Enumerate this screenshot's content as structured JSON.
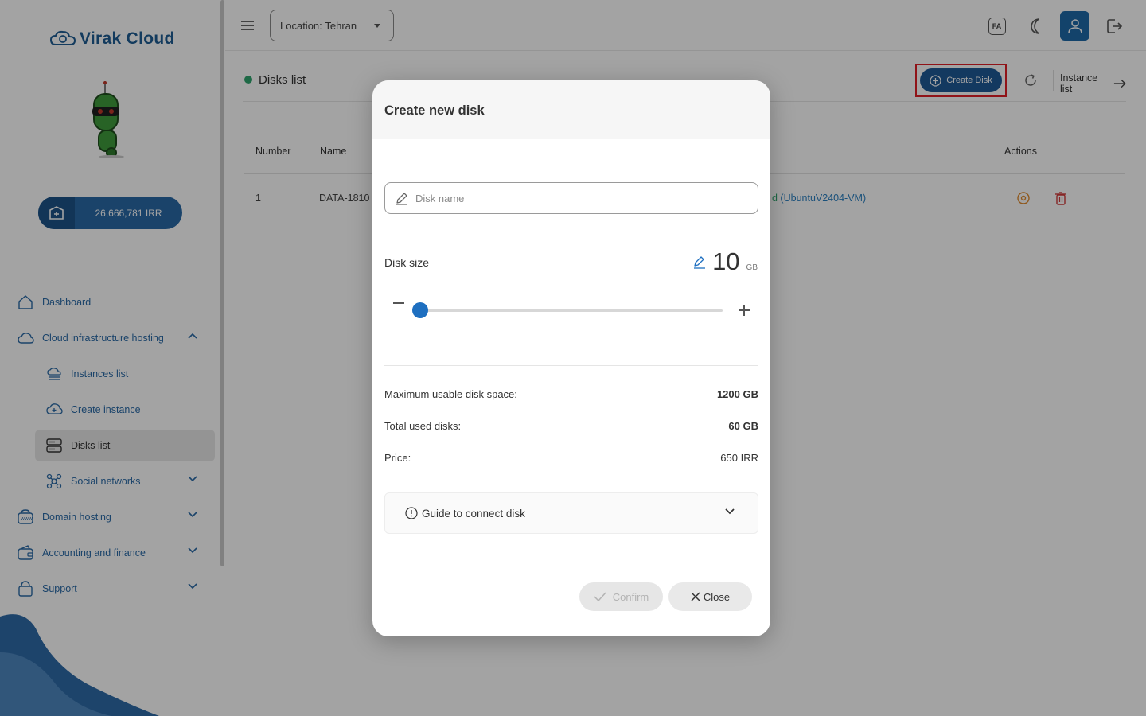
{
  "brand": {
    "name": "Virak Cloud"
  },
  "sidebar": {
    "balance": "26,666,781 IRR",
    "items": [
      {
        "label": "Dashboard"
      },
      {
        "label": "Cloud infrastructure hosting"
      },
      {
        "label": "Instances list"
      },
      {
        "label": "Create instance"
      },
      {
        "label": "Disks list"
      },
      {
        "label": "Social networks"
      },
      {
        "label": "Domain hosting"
      },
      {
        "label": "Accounting and finance"
      },
      {
        "label": "Support"
      }
    ]
  },
  "topbar": {
    "location_label": "Location:",
    "location_value": "Tehran",
    "lang_badge": "FA"
  },
  "page": {
    "section_title": "Disks list",
    "create_disk_label": "Create Disk",
    "instance_list_label": "Instance list",
    "table": {
      "headers": {
        "number": "Number",
        "name": "Name",
        "actions": "Actions"
      },
      "rows": [
        {
          "number": "1",
          "name": "DATA-1810",
          "attached_prefix": "d",
          "attached": " (UbuntuV2404-VM)"
        }
      ]
    }
  },
  "modal": {
    "title": "Create new disk",
    "disk_name_placeholder": "Disk name",
    "disk_size_label": "Disk size",
    "disk_size_value": "10",
    "disk_size_unit": "GB",
    "slider_fraction": 0,
    "max_space_label": "Maximum usable disk space:",
    "max_space_value": "1200 GB",
    "used_label": "Total used disks:",
    "used_value": "60 GB",
    "price_label": "Price:",
    "price_value": "650 IRR",
    "guide_label": "Guide to connect disk",
    "confirm_label": "Confirm",
    "close_label": "Close"
  },
  "colors": {
    "primary": "#1f5a97",
    "accent_blue": "#1e6fc0",
    "status_green": "#2fa56e",
    "highlight_red": "#e21e26"
  }
}
